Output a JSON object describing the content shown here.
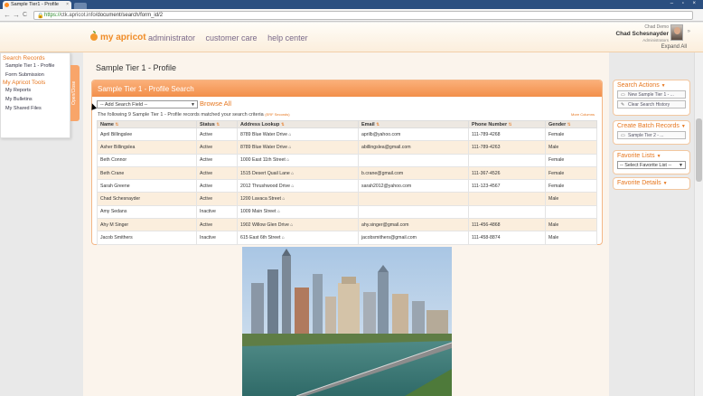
{
  "browser": {
    "tab_title": "Sample Tier1 - Profile",
    "tab_close": "×",
    "window_controls": "– ▫ ×",
    "back": "←",
    "forward": "→",
    "reload": "C",
    "url_scheme": "https://",
    "url_domain": "ctk.apricot.info",
    "url_path": "/document/search/form_id/2"
  },
  "header": {
    "logo": "my apricot",
    "nav": [
      "administrator",
      "customer care",
      "help center"
    ],
    "user_top": "Chad Demo",
    "user_name": "Chad Schesnayder",
    "user_role": "Administrators",
    "expand_all": "Expand All"
  },
  "sidebar": {
    "search_heading": "Search Records",
    "search_items": [
      "Sample Tier 1 - Profile",
      "Form Submission"
    ],
    "tools_heading": "My Apricot Tools",
    "tools_items": [
      "My Reports",
      "My Bulletins",
      "My Shared Files"
    ],
    "open_tab": "Open/Close"
  },
  "main": {
    "page_title": "Sample Tier 1 - Profile",
    "panel_title": "Sample Tier 1 - Profile Search",
    "field_select": "-- Add Search Field --",
    "browse_all": "Browse All",
    "match_text": "The following 9 Sample Tier 1 - Profile records matched your search criteria",
    "match_small": "(ERF Seconds)",
    "hide_columns": "More Columns"
  },
  "table": {
    "columns": [
      "Name",
      "Status",
      "Address Lookup",
      "Email",
      "Phone Number",
      "Gender"
    ],
    "rows": [
      [
        "April Billingslee",
        "Active",
        "8789 Blue Water Drive",
        "aprilb@yahoo.com",
        "111-789-4268",
        "Female"
      ],
      [
        "Asher Billingslea",
        "Active",
        "8789 Blue Water Drive",
        "abillingslea@gmail.com",
        "111-789-4263",
        "Male"
      ],
      [
        "Beth Connor",
        "Active",
        "1000 East 11th Street",
        "",
        "",
        "Female"
      ],
      [
        "Beth Crane",
        "Active",
        "1515 Desert Quail Lane",
        "b.crane@gmail.com",
        "111-367-4526",
        "Female"
      ],
      [
        "Sarah Greene",
        "Active",
        "2012 Thrushwood Drive",
        "sarah2012@yahoo.com",
        "111-123-4567",
        "Female"
      ],
      [
        "Chad Schesnayder",
        "Active",
        "1200 Lavaca Street",
        "",
        "",
        "Male"
      ],
      [
        "Amy Sedans",
        "Inactive",
        "1009 Main Street",
        "",
        "",
        ""
      ],
      [
        "Ahy M Singer",
        "Active",
        "1902 Willow Glen Drive",
        "ahy.singer@gmail.com",
        "111-456-4868",
        "Male"
      ],
      [
        "Jacob Smithers",
        "Inactive",
        "615 East 6th Street",
        "jacobsmithers@gmail.com",
        "111-458-8874",
        "Male"
      ]
    ]
  },
  "right_panel": {
    "search_actions": "Search Actions",
    "new_search": "New Sample Tier 1 - ...",
    "clear_history": "Clear Search History",
    "create_batch": "Create Batch Records",
    "batch_item": "Sample Tier 2 - ...",
    "favorite_lists": "Favorite Lists",
    "favorite_select": "-- Select Favorite List --",
    "favorite_details": "Favorite Details"
  }
}
